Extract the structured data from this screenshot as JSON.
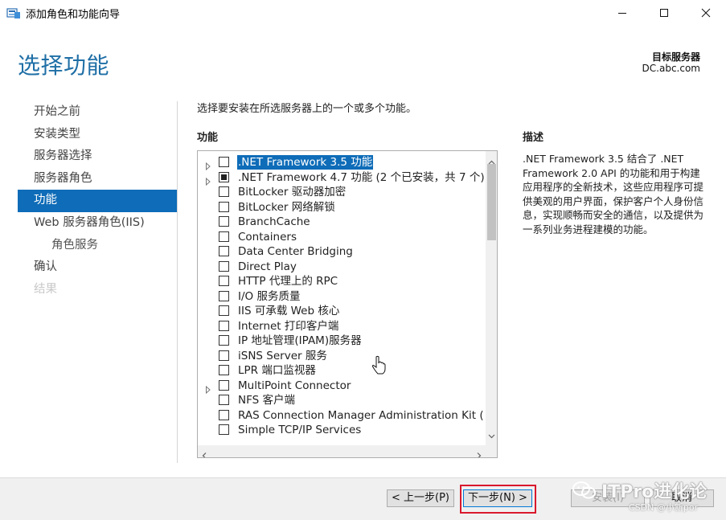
{
  "window": {
    "title": "添加角色和功能向导",
    "icon": "server-manager-icon",
    "controls": [
      "minimize-icon",
      "maximize-icon",
      "close-icon"
    ]
  },
  "header": {
    "page_title": "选择功能",
    "target_label": "目标服务器",
    "target_value": "DC.abc.com"
  },
  "nav": {
    "items": [
      {
        "label": "开始之前",
        "state": "normal"
      },
      {
        "label": "安装类型",
        "state": "normal"
      },
      {
        "label": "服务器选择",
        "state": "normal"
      },
      {
        "label": "服务器角色",
        "state": "normal"
      },
      {
        "label": "功能",
        "state": "active"
      },
      {
        "label": "Web 服务器角色(IIS)",
        "state": "normal"
      },
      {
        "label": "角色服务",
        "state": "sub"
      },
      {
        "label": "确认",
        "state": "normal"
      },
      {
        "label": "结果",
        "state": "disabled"
      }
    ]
  },
  "main": {
    "instruction": "选择要安装在所选服务器上的一个或多个功能。",
    "features_label": "功能",
    "features": [
      {
        "label": ".NET Framework 3.5 功能",
        "expandable": true,
        "check": "unchecked",
        "selected": true
      },
      {
        "label": ".NET Framework 4.7 功能 (2 个已安装，共 7 个)",
        "expandable": true,
        "check": "partial",
        "selected": false
      },
      {
        "label": "BitLocker 驱动器加密",
        "expandable": false,
        "check": "unchecked",
        "selected": false
      },
      {
        "label": "BitLocker 网络解锁",
        "expandable": false,
        "check": "unchecked",
        "selected": false
      },
      {
        "label": "BranchCache",
        "expandable": false,
        "check": "unchecked",
        "selected": false
      },
      {
        "label": "Containers",
        "expandable": false,
        "check": "unchecked",
        "selected": false
      },
      {
        "label": "Data Center Bridging",
        "expandable": false,
        "check": "unchecked",
        "selected": false
      },
      {
        "label": "Direct Play",
        "expandable": false,
        "check": "unchecked",
        "selected": false
      },
      {
        "label": "HTTP 代理上的 RPC",
        "expandable": false,
        "check": "unchecked",
        "selected": false
      },
      {
        "label": "I/O 服务质量",
        "expandable": false,
        "check": "unchecked",
        "selected": false
      },
      {
        "label": "IIS 可承载 Web 核心",
        "expandable": false,
        "check": "unchecked",
        "selected": false
      },
      {
        "label": "Internet 打印客户端",
        "expandable": false,
        "check": "unchecked",
        "selected": false
      },
      {
        "label": "IP 地址管理(IPAM)服务器",
        "expandable": false,
        "check": "unchecked",
        "selected": false
      },
      {
        "label": "iSNS Server 服务",
        "expandable": false,
        "check": "unchecked",
        "selected": false
      },
      {
        "label": "LPR 端口监视器",
        "expandable": false,
        "check": "unchecked",
        "selected": false
      },
      {
        "label": "MultiPoint Connector",
        "expandable": true,
        "check": "unchecked",
        "selected": false
      },
      {
        "label": "NFS 客户端",
        "expandable": false,
        "check": "unchecked",
        "selected": false
      },
      {
        "label": "RAS Connection Manager Administration Kit (",
        "expandable": false,
        "check": "unchecked",
        "selected": false
      },
      {
        "label": "Simple TCP/IP Services",
        "expandable": false,
        "check": "unchecked",
        "selected": false
      }
    ],
    "description_label": "描述",
    "description_text": ".NET Framework 3.5 结合了 .NET Framework 2.0 API 的功能和用于构建应用程序的全新技术，这些应用程序可提供美观的用户界面，保护客户个人身份信息，实现顺畅而安全的通信，以及提供为一系列业务进程建模的功能。"
  },
  "footer": {
    "prev_label": "< 上一步(P)",
    "next_label": "下一步(N) >",
    "install_label": "安装(I)",
    "cancel_label": "取消"
  },
  "overlay": {
    "watermark": "ITPro进化论",
    "watermark_sub": "CSDN @小新por",
    "highlight_color": "#d9182d"
  },
  "colors": {
    "accent": "#0e6cb8",
    "title": "#1f6fa6",
    "highlight": "#d9182d"
  }
}
